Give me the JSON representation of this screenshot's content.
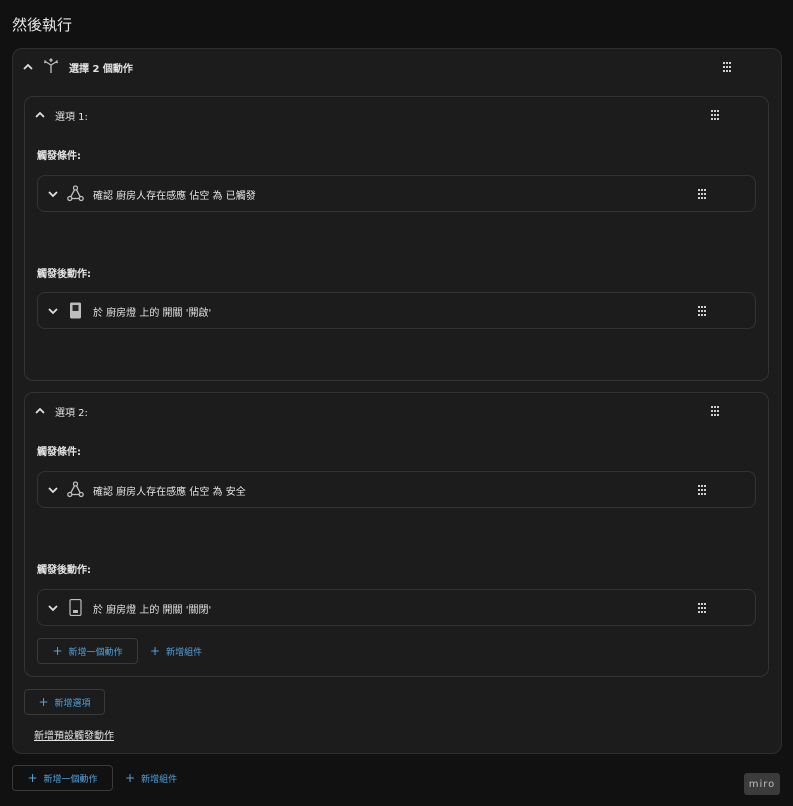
{
  "page": {
    "title": "然後執行"
  },
  "choose": {
    "header_label": "選擇 2 個動作",
    "options": [
      {
        "title": "選項 1:",
        "conditions_label": "觸發條件:",
        "condition_text": "確認 廚房人存在感應 佔空 為 已觸發",
        "actions_label": "觸發後動作:",
        "action_text": "於 廚房燈 上的 開關 '開啟'"
      },
      {
        "title": "選項 2:",
        "conditions_label": "觸發條件:",
        "condition_text": "確認 廚房人存在感應 佔空 為 安全",
        "actions_label": "觸發後動作:",
        "action_text": "於 廚房燈 上的 開關 '關閉'",
        "add_action": "新增一個動作",
        "add_block": "新增組件"
      }
    ],
    "add_option": "新增選項",
    "add_default": "新增預設觸發動作"
  },
  "footer": {
    "add_action": "新增一個動作",
    "add_block": "新增組件"
  },
  "badge": "miro",
  "colors": {
    "background": "#111111",
    "card": "#1c1c1c",
    "border": "#333333",
    "accent": "#4fa3e0"
  }
}
